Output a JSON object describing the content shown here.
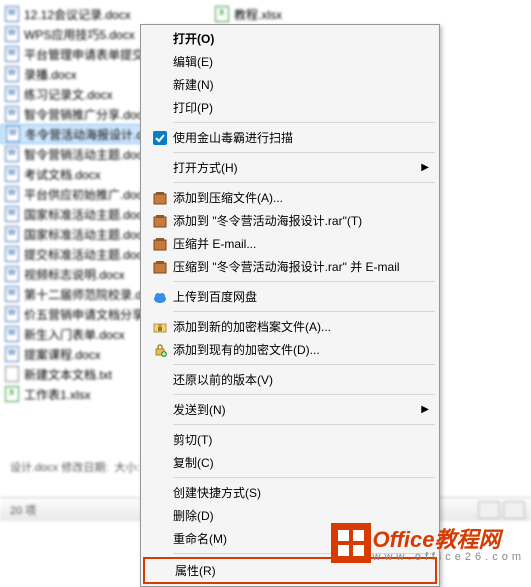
{
  "files": {
    "col1": [
      "12.12会议记录.docx",
      "WPS应用技巧5.docx",
      "平台管理申请表单提交.docx",
      "录播.docx",
      "练习记录文.docx",
      "智令营销推广分享.docx",
      "冬令营活动海报设计.docx",
      "智令营销活动主题.docx",
      "考试文档.docx",
      "平台供应初始推广.docx",
      "国家标准活动主题.docx",
      "国家标准活动主题.docx",
      "提交标准活动主题.docx",
      "视频标志说明.docx",
      "第十二届师范院校录.docx",
      "价五营销申请文档分享.docx",
      "新生入门表单.docx",
      "提案课程.docx",
      "新建文本文档.txt",
      "工作表1.xlsx"
    ],
    "col2": [
      "教程.xlsx"
    ],
    "selected_index": 6
  },
  "menu": {
    "open": "打开(O)",
    "edit": "编辑(E)",
    "new": "新建(N)",
    "print": "打印(P)",
    "kingsoft_scan": "使用金山毒霸进行扫描",
    "open_with": "打开方式(H)",
    "add_to_archive": "添加到压缩文件(A)...",
    "add_to_named": "添加到 \"冬令营活动海报设计.rar\"(T)",
    "compress_email": "压缩并 E-mail...",
    "compress_to_email": "压缩到 \"冬令营活动海报设计.rar\" 并 E-mail",
    "upload_baidu": "上传到百度网盘",
    "add_new_encrypted": "添加到新的加密档案文件(A)...",
    "add_existing_encrypted": "添加到现有的加密文件(D)...",
    "restore_previous": "还原以前的版本(V)",
    "send_to": "发送到(N)",
    "cut": "剪切(T)",
    "copy": "复制(C)",
    "create_shortcut": "创建快捷方式(S)",
    "delete": "删除(D)",
    "rename": "重命名(M)",
    "properties": "属性(R)"
  },
  "status": {
    "file": "设计.docx 修改日期:",
    "size": "大小:"
  },
  "bottom": {
    "left": "20 项"
  },
  "watermark": {
    "main": "Office教程网",
    "sub": "www.office26.com"
  }
}
